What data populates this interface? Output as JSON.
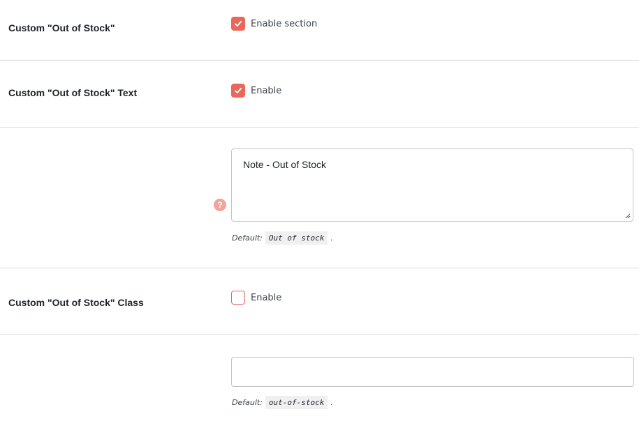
{
  "settings": {
    "section": {
      "label": "Custom \"Out of Stock\"",
      "checkbox_label": "Enable section",
      "checked": true
    },
    "text": {
      "label": "Custom \"Out of Stock\" Text",
      "checkbox_label": "Enable",
      "checked": true,
      "textarea_value": "Note - Out of Stock",
      "default_prefix": "Default:",
      "default_value": "Out of stock",
      "default_suffix": "."
    },
    "class": {
      "label": "Custom \"Out of Stock\" Class",
      "checkbox_label": "Enable",
      "checked": false,
      "input_value": "",
      "default_prefix": "Default:",
      "default_value": "out-of-stock",
      "default_suffix": "."
    }
  },
  "help_icon": {
    "glyph": "?",
    "icon": "question-circle-icon"
  },
  "colors": {
    "accent": "#e8685c",
    "help_icon": "#f3a39a"
  }
}
